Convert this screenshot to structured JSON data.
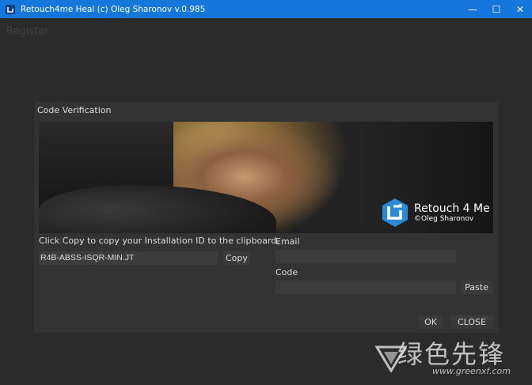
{
  "window": {
    "title": "Retouch4me Heal (c) Oleg Sharonov v.0.985",
    "controls": {
      "minimize": "—",
      "maximize": "☐",
      "close": "✕"
    }
  },
  "menu": {
    "register": "Register"
  },
  "dialog": {
    "title": "Code Verification",
    "banner": {
      "brand_name": "Retouch 4 Me",
      "brand_sub": "©Oleg Sharonov"
    },
    "instruction": "Click Copy to copy your Installation ID to the clipboard.",
    "installation_id": "R4B-ABSS-ISQR-MIN.JT",
    "copy_label": "Copy",
    "email_label": "Email",
    "email_value": "",
    "code_label": "Code",
    "code_value": "",
    "paste_label": "Paste",
    "ok_label": "OK",
    "close_label": "CLOSE"
  },
  "watermark": {
    "text": "绿色先锋",
    "url": "www.greenxf.com"
  },
  "colors": {
    "titlebar": "#1577dc",
    "background": "#2b2b2b",
    "dialog": "#333333",
    "brand_blue": "#2a8bd8"
  }
}
